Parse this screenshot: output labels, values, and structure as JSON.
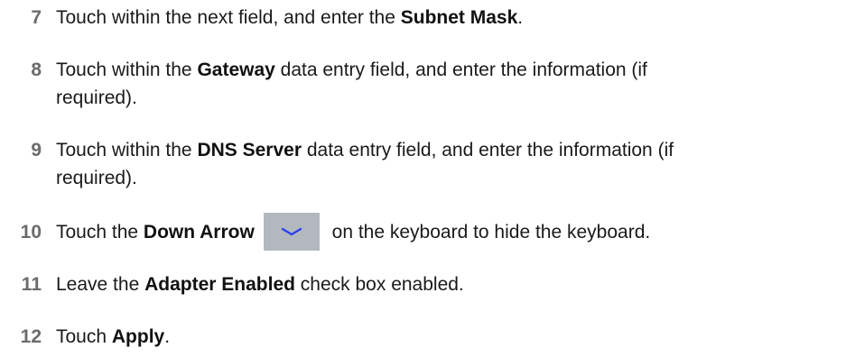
{
  "steps": [
    {
      "number": "7",
      "pre": "Touch within the next field, and enter the ",
      "bold": "Subnet Mask",
      "post": "."
    },
    {
      "number": "8",
      "pre": "Touch within the ",
      "bold": "Gateway",
      "post": " data entry field, and enter the information (if",
      "line2": "required)."
    },
    {
      "number": "9",
      "pre": "Touch within the ",
      "bold": "DNS Server",
      "post": " data entry field, and enter the information (if",
      "line2": "required)."
    },
    {
      "number": "10",
      "pre": "Touch the ",
      "bold": "Down Arrow",
      "icon": "chevron-down-icon",
      "post": "on the keyboard to hide the keyboard."
    },
    {
      "number": "11",
      "pre": "Leave the ",
      "bold": "Adapter Enabled",
      "post": " check box enabled."
    },
    {
      "number": "12",
      "pre": "Touch ",
      "bold": "Apply",
      "post": "."
    }
  ],
  "colors": {
    "step_number": "#6b6b6b",
    "key_background": "#b3b8bf",
    "chevron": "#2a3cf0"
  }
}
